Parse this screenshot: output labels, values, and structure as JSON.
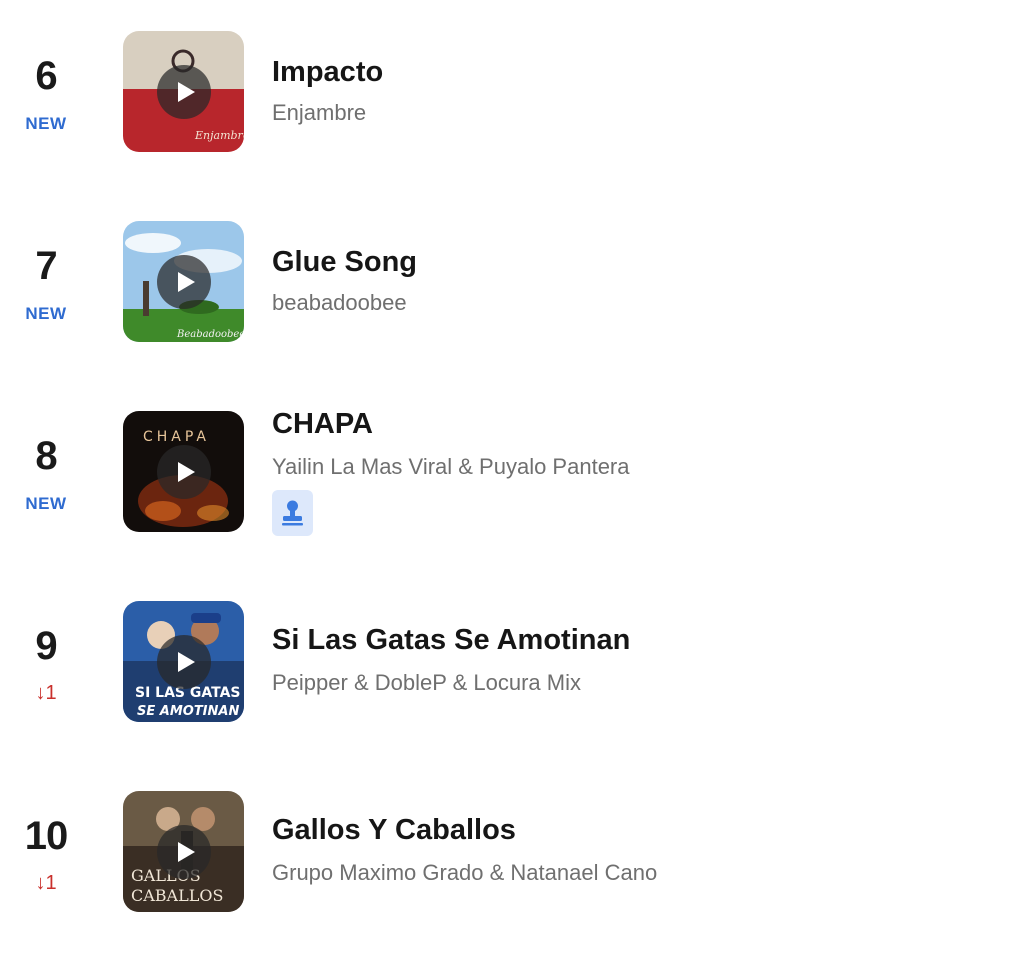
{
  "chart": {
    "entries": [
      {
        "rank": "6",
        "status": "NEW",
        "title": "Impacto",
        "artist": "Enjambre",
        "cover_icon": "album-cover"
      },
      {
        "rank": "7",
        "status": "NEW",
        "title": "Glue Song",
        "artist": "beabadoobee",
        "cover_icon": "album-cover"
      },
      {
        "rank": "8",
        "status": "NEW",
        "title": "CHAPA",
        "artist": "Yailin La Mas Viral & Puyalo Pantera",
        "badge_icon": "stamp-icon"
      },
      {
        "rank": "9",
        "status": "↓1",
        "title": "Si Las Gatas Se Amotinan",
        "artist": "Peipper & DobleP & Locura Mix"
      },
      {
        "rank": "10",
        "status": "↓1",
        "title": "Gallos Y Caballos",
        "artist": "Grupo Maximo Grado & Natanael Cano"
      }
    ]
  },
  "colors": {
    "new_status": "#2f6bd0",
    "down_status": "#c9302c",
    "badge_bg": "#dde8fb",
    "badge_icon": "#3b7be0"
  }
}
